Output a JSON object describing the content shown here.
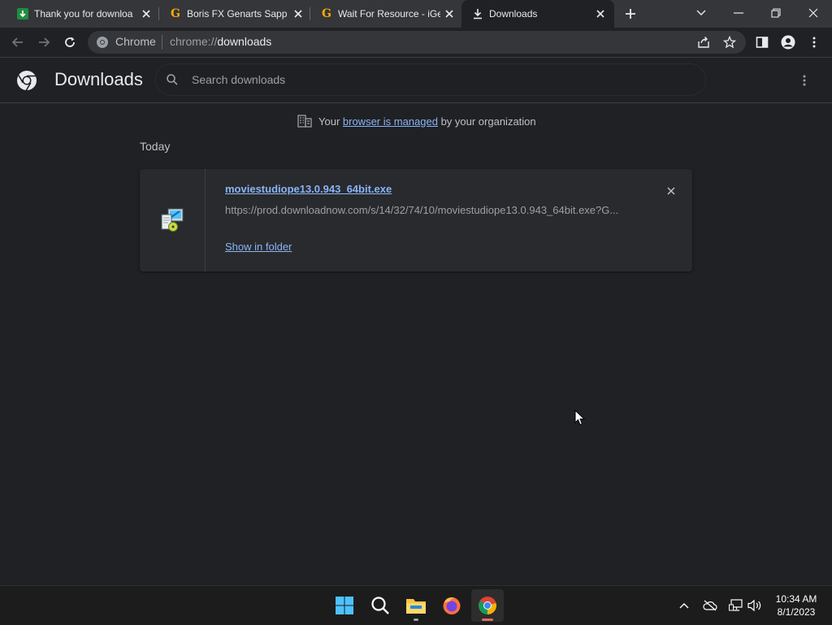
{
  "tabs": [
    {
      "title": "Thank you for downloa",
      "favicon": "green-download-icon",
      "active": false
    },
    {
      "title": "Boris FX Genarts Sapph",
      "favicon": "g-logo-icon",
      "active": false
    },
    {
      "title": "Wait For Resource - iGe",
      "favicon": "g-logo-icon",
      "active": false
    },
    {
      "title": "Downloads",
      "favicon": "download-icon",
      "active": true
    }
  ],
  "omnibox": {
    "site_label": "Chrome",
    "url_scheme": "chrome://",
    "url_host": "downloads"
  },
  "page": {
    "title": "Downloads",
    "search_placeholder": "Search downloads"
  },
  "managed": {
    "prefix": "Your ",
    "link": "browser is managed",
    "suffix": " by your organization"
  },
  "downloads": {
    "section_label": "Today",
    "items": [
      {
        "file_name": "moviestudiope13.0.943_64bit.exe",
        "url": "https://prod.downloadnow.com/s/14/32/74/10/moviestudiope13.0.943_64bit.exe?G...",
        "action_label": "Show in folder"
      }
    ]
  },
  "taskbar": {
    "apps": [
      "start-icon",
      "search-icon",
      "file-explorer-icon",
      "firefox-icon",
      "chrome-icon"
    ],
    "time": "10:34 AM",
    "date": "8/1/2023"
  },
  "colors": {
    "background": "#202124",
    "tabstrip": "#35363a",
    "link": "#8ab4f8",
    "card": "#292a2d"
  }
}
